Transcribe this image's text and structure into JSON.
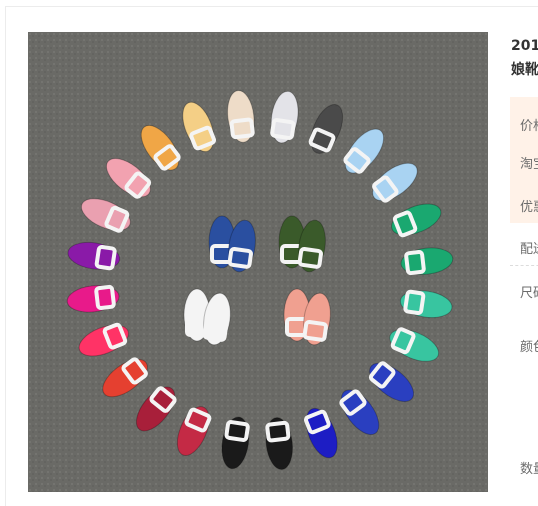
{
  "product": {
    "title_line1": "201",
    "title_line2": "娘靴",
    "image_icon": "shoe-photo"
  },
  "labels": {
    "price": "价格",
    "taobao_price": "淘宝",
    "promo": "优惠",
    "delivery": "配送",
    "size": "尺码",
    "color": "颜色",
    "quantity": "数量"
  },
  "colors": {
    "accent_bg": "#fff2e8",
    "photo_bg": "#6b6b68"
  }
}
